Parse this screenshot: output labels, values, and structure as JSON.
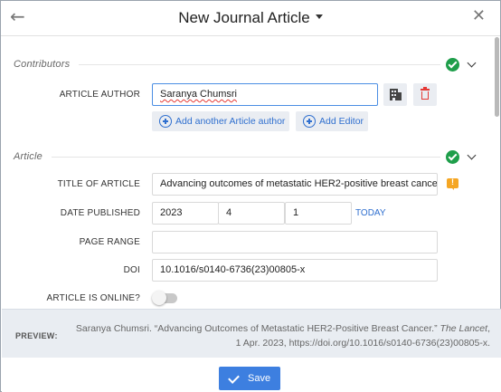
{
  "header": {
    "title": "New Journal Article"
  },
  "contributors": {
    "section_title": "Contributors",
    "author_label": "ARTICLE AUTHOR",
    "author_value": "Saranya Chumsri",
    "add_author_label": "Add another Article author",
    "add_editor_label": "Add Editor"
  },
  "article": {
    "section_title": "Article",
    "title_label": "TITLE OF ARTICLE",
    "title_value": "Advancing outcomes of metastatic HER2-positive breast cancer",
    "date_label": "DATE PUBLISHED",
    "date_year": "2023",
    "date_month": "4",
    "date_day": "1",
    "today_label": "TODAY",
    "page_range_label": "PAGE RANGE",
    "page_range_value": "",
    "doi_label": "DOI",
    "doi_value": "10.1016/s0140-6736(23)00805-x",
    "online_label": "ARTICLE IS ONLINE?",
    "online_value": false
  },
  "preview": {
    "label": "PREVIEW:",
    "text_before": "Saranya Chumsri. “Advancing Outcomes of Metastatic HER2-Positive Breast Cancer.”",
    "journal": "The Lancet",
    "text_after": ", 1 Apr. 2023, https://doi.org/10.1016/s0140-6736(23)00805-x."
  },
  "footer": {
    "save_label": "Save"
  },
  "colors": {
    "accent": "#3d7fe0",
    "link": "#2f6fcf",
    "success": "#1e9e4a",
    "danger": "#e53935",
    "warning": "#f5a623"
  },
  "icons": [
    "back-arrow-icon",
    "caret-down-icon",
    "close-icon",
    "check-circle-icon",
    "chevron-down-icon",
    "building-icon",
    "trash-icon",
    "plus-circle-icon",
    "note-warning-icon",
    "checkmark-icon"
  ]
}
